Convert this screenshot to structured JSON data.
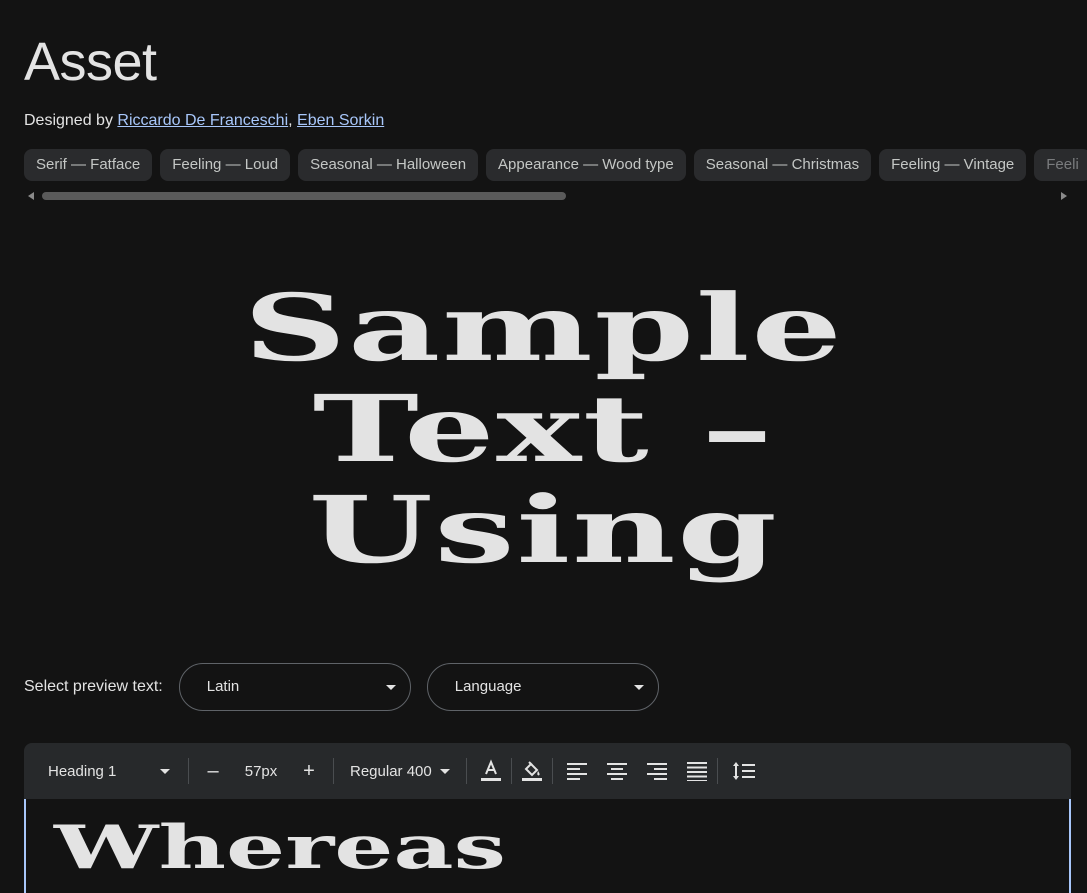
{
  "font": {
    "name": "Asset",
    "designed_by_label": "Designed by",
    "designers": [
      "Riccardo De Franceschi",
      "Eben Sorkin"
    ],
    "designer_separator": ","
  },
  "tags": [
    "Serif — Fatface",
    "Feeling — Loud",
    "Seasonal — Halloween",
    "Appearance — Wood type",
    "Seasonal — Christmas",
    "Feeling — Vintage",
    "Feeli"
  ],
  "preview": {
    "lines": [
      "Sample",
      "Text –",
      "Using"
    ]
  },
  "preview_select": {
    "label": "Select preview text:",
    "script_value": "Latin",
    "language_value": "Language"
  },
  "toolbar": {
    "style_value": "Heading 1",
    "decrease_label": "–",
    "size_value": "57px",
    "increase_label": "+",
    "weight_value": "Regular 400"
  },
  "editor": {
    "text": "Whereas"
  },
  "colors": {
    "background": "#131313",
    "chip": "#2a2b2d",
    "link": "#a8c7fa",
    "toolbar": "#27292b"
  }
}
